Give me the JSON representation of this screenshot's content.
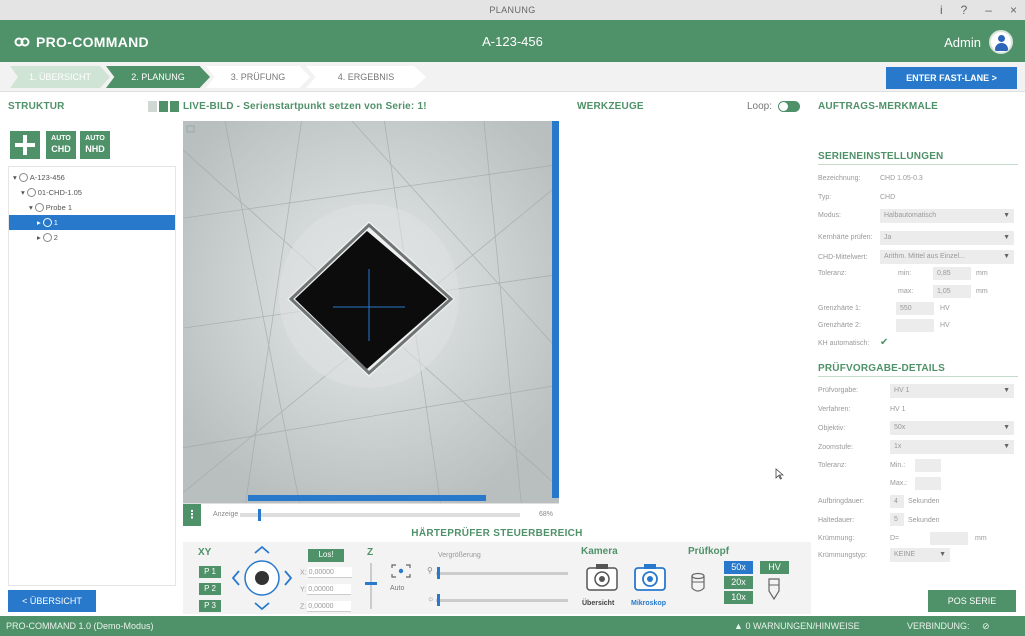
{
  "window": {
    "title": "PLANUNG",
    "controls": [
      "i",
      "?",
      "–",
      "×"
    ]
  },
  "header": {
    "logo_text": "PRO-COMMAND",
    "order": "A-123-456",
    "user": "Admin"
  },
  "steps": [
    {
      "label": "1. ÜBERSICHT",
      "state": "done"
    },
    {
      "label": "2. PLANUNG",
      "state": "active"
    },
    {
      "label": "3. PRÜFUNG",
      "state": "pending"
    },
    {
      "label": "4. ERGEBNIS",
      "state": "pending"
    }
  ],
  "fastlane_label": "ENTER FAST-LANE >",
  "struktur": {
    "title": "STRUKTUR",
    "auto_chd": {
      "top": "AUTO",
      "bottom": "CHD"
    },
    "auto_nhd": {
      "top": "AUTO",
      "bottom": "NHD"
    },
    "tree": [
      {
        "label": "A-123-456",
        "indent": 0
      },
      {
        "label": "01-CHD-1.05",
        "indent": 1
      },
      {
        "label": "Probe 1",
        "indent": 2
      },
      {
        "label": "1",
        "indent": 3,
        "selected": true
      },
      {
        "label": "2",
        "indent": 3
      }
    ]
  },
  "live": {
    "title": "LIVE-BILD - Serienstartpunkt setzen von Serie: 1!",
    "anzeige_label": "Anzeige",
    "zoom_percent": "68%"
  },
  "werkzeuge": {
    "title": "WERKZEUGE",
    "loop_label": "Loop:"
  },
  "auftrag": {
    "title": "AUFTRAGS-MERKMALE"
  },
  "serien": {
    "title": "SERIENEINSTELLUNGEN",
    "bezeichnung_label": "Bezeichnung:",
    "bezeichnung": "CHD 1.05-0.3",
    "typ_label": "Typ:",
    "typ": "CHD",
    "modus_label": "Modus:",
    "modus": "Halbautomatisch",
    "kernhaerte_label": "Kernhärte prüfen:",
    "kernhaerte": "Ja",
    "mittelwert_label": "CHD-Mittelwert:",
    "mittelwert": "Arithm. Mittel aus Einzel...",
    "toleranz_label": "Toleranz:",
    "min_label": "min:",
    "min": "0,85",
    "max_label": "max:",
    "max": "1,05",
    "unit_mm": "mm",
    "grenz1_label": "Grenzhärte 1:",
    "grenz1": "550",
    "grenz2_label": "Grenzhärte 2:",
    "unit_hv": "HV",
    "kh_label": "KH automatisch:",
    "kh_check": "✔"
  },
  "pruef": {
    "title": "PRÜFVORGABE-DETAILS",
    "pv_label": "Prüfvorgabe:",
    "pv": "HV 1",
    "verf_label": "Verfahren:",
    "verf": "HV 1",
    "obj_label": "Objektiv:",
    "obj": "50x",
    "zoom_label": "Zoomstufe:",
    "zoom": "1x",
    "tol_label": "Toleranz:",
    "tol_min": "Min.:",
    "tol_max": "Max.:",
    "aufbring_label": "Aufbringdauer:",
    "aufbring": "4",
    "haltedauer_label": "Haltedauer:",
    "haltedauer": "5",
    "sek": "Sekunden",
    "kruemmung_label": "Krümmung:",
    "kruemmung_d": "D=",
    "kruemmung_mm": "mm",
    "ktyp_label": "Krümmungstyp:",
    "ktyp": "KEINE"
  },
  "haerte": {
    "title": "HÄRTEPRÜFER STEUERBEREICH",
    "xy": "XY",
    "los": "Los!",
    "z": "Z",
    "p1": "P 1",
    "p2": "P 2",
    "p3": "P 3",
    "x": "X:",
    "x_val": "0,00000",
    "y": "Y:",
    "y_val": "0,00000",
    "zc": "Z:",
    "z_val": "0,00000",
    "auto": "Auto",
    "vergroesserung": "Vergrößerung",
    "kamera": "Kamera",
    "uebersicht": "Übersicht",
    "mikroskop": "Mikroskop",
    "pruefkopf": "Prüfkopf",
    "m50": "50x",
    "m20": "20x",
    "m10": "10x",
    "hv": "HV"
  },
  "buttons": {
    "uebersicht": "< ÜBERSICHT",
    "pos_serie": "POS SERIE"
  },
  "status": {
    "left": "PRO-COMMAND 1.0 (Demo-Modus)",
    "warnings": "0 WARNUNGEN/HINWEISE",
    "verbindung": "VERBINDUNG:",
    "verbindung_icon": "⊘"
  }
}
